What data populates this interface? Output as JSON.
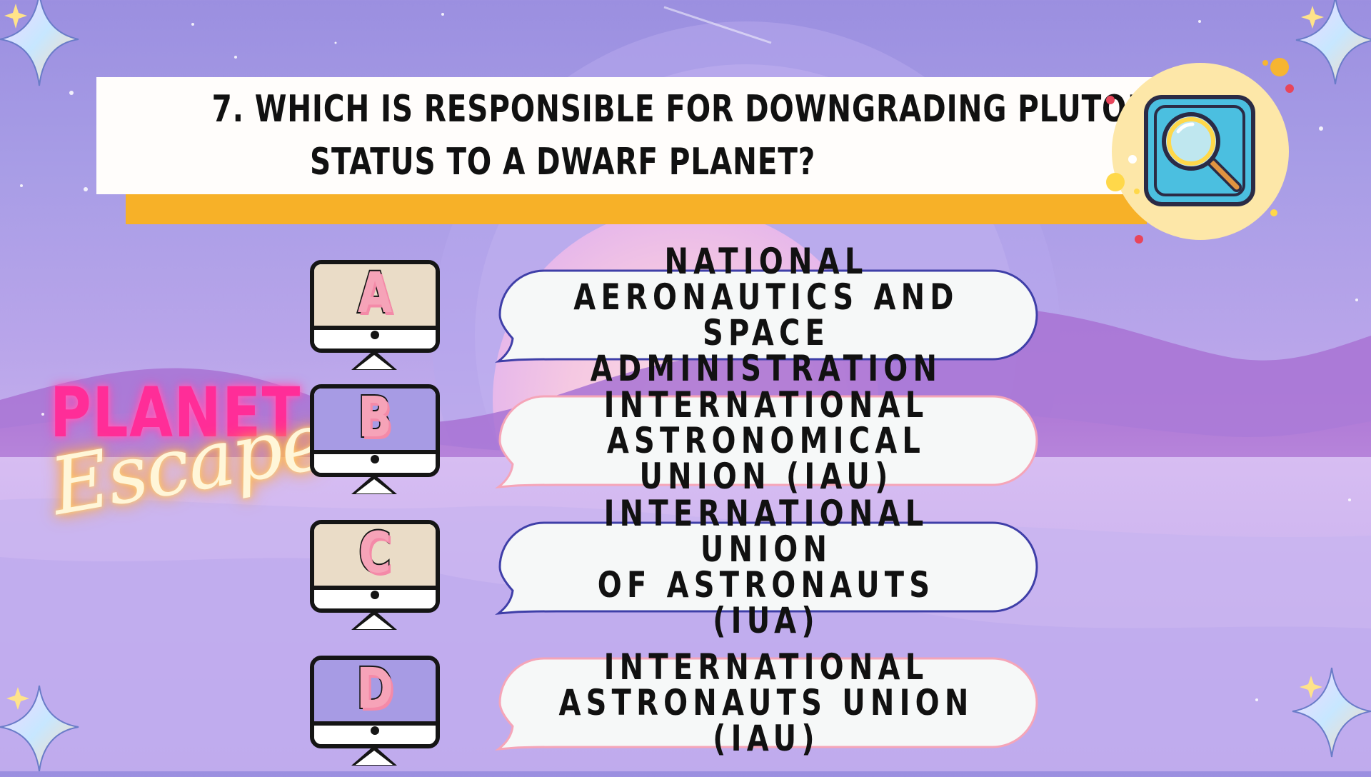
{
  "question": {
    "line1": "7. WHICH IS RESPONSIBLE FOR DOWNGRADING PLUTO’S",
    "line2": "STATUS TO A DWARF PLANET?"
  },
  "logo": {
    "word1": "PLANET",
    "word2": "Escape"
  },
  "options": [
    {
      "letter": "A",
      "text": "NATIONAL AERONAUTICS AND\nSPACE ADMINISTRATION",
      "screen_color": "#eadcc7",
      "bubble_border": "#3f3fa8"
    },
    {
      "letter": "B",
      "text": "INTERNATIONAL\nASTRONOMICAL UNION (IAU)",
      "screen_color": "#a79be4",
      "bubble_border": "#f5a5b8"
    },
    {
      "letter": "C",
      "text": "INTERNATIONAL UNION\nOF ASTRONAUTS (IUA)",
      "screen_color": "#eadcc7",
      "bubble_border": "#3f3fa8"
    },
    {
      "letter": "D",
      "text": "INTERNATIONAL\nASTRONAUTS UNION (IAU)",
      "screen_color": "#a79be4",
      "bubble_border": "#f5a5b8"
    }
  ],
  "icons": {
    "badge": "magnifying-glass-icon",
    "sparkles": "sparkle-icon"
  },
  "colors": {
    "banner_accent": "#f7b128",
    "logo_pink": "#ff2d98",
    "badge_bg": "#fde7a8",
    "icon_blue": "#4bbfe0"
  }
}
